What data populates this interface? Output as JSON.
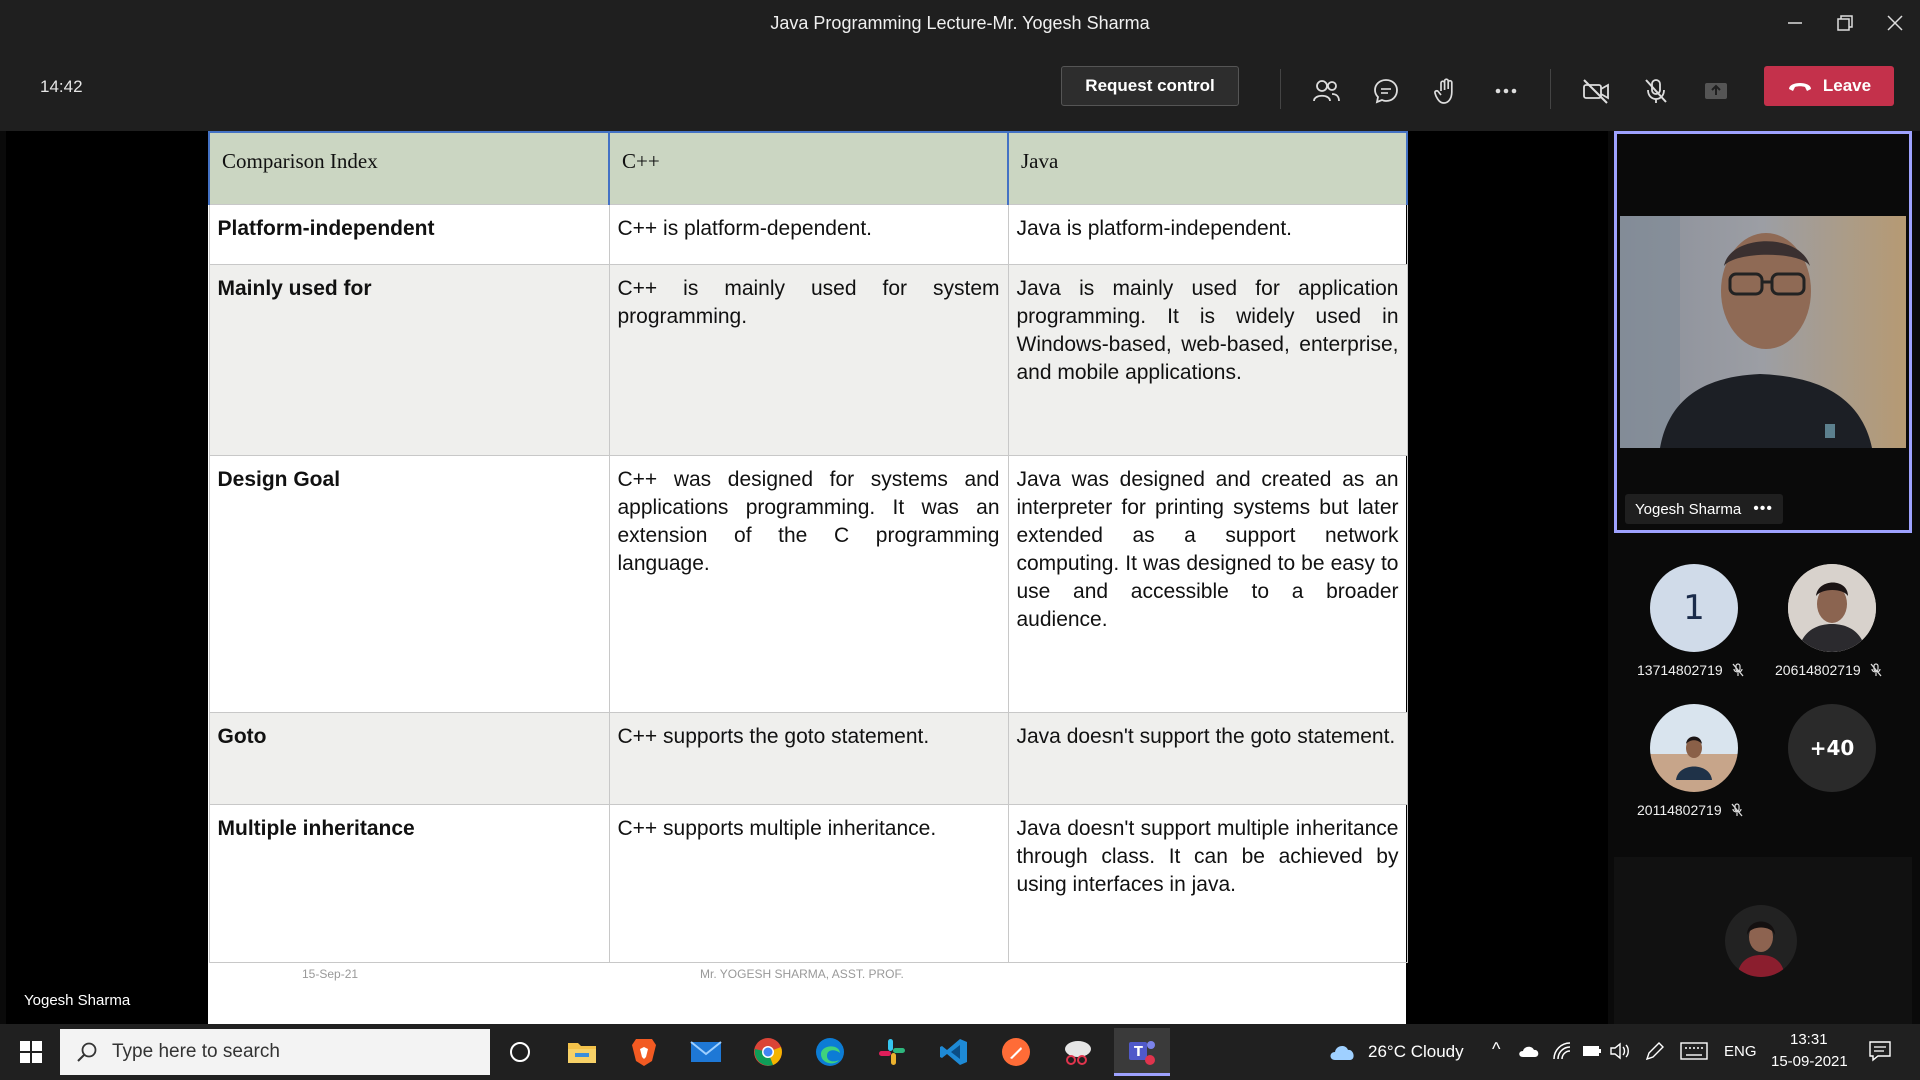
{
  "window": {
    "title": "Java Programming Lecture-Mr. Yogesh Sharma",
    "controls": [
      "minimize-icon",
      "restore-icon",
      "close-icon"
    ]
  },
  "toolbar": {
    "timer": "14:42",
    "request_control_label": "Request control",
    "leave_label": "Leave",
    "icons": [
      "participants-icon",
      "chat-icon",
      "raise-hand-icon",
      "more-icon",
      "camera-off-icon",
      "mic-off-icon",
      "share-icon",
      "phone-hangup-icon"
    ],
    "leave_color": "#c4314b"
  },
  "slide": {
    "headers": [
      "Comparison Index",
      "C++",
      "Java"
    ],
    "rows": [
      {
        "index": "Platform-independent",
        "cpp": "C++ is platform-dependent.",
        "java": "Java is platform-independent."
      },
      {
        "index": "Mainly used for",
        "cpp": "C++ is mainly used for system programming.",
        "java": "Java is mainly used for application programming. It is widely used in Windows-based, web-based, enterprise, and mobile applications."
      },
      {
        "index": "Design Goal",
        "cpp": "C++ was designed for systems and applications programming. It was an extension of the C programming language.",
        "java": "Java was designed and created as an interpreter for printing systems but later extended as a support network computing. It was designed to be easy to use and accessible to a broader audience."
      },
      {
        "index": "Goto",
        "cpp": "C++ supports the goto statement.",
        "java": "Java doesn't support the goto statement."
      },
      {
        "index": "Multiple inheritance",
        "cpp": "C++ supports multiple inheritance.",
        "java": "Java doesn't support multiple inheritance through class. It can be achieved by using interfaces in java."
      }
    ],
    "footer_date": "15-Sep-21",
    "footer_author": "Mr. YOGESH SHARMA, ASST. PROF.",
    "header_bg": "#cbd6c2"
  },
  "stage": {
    "presenter_name": "Yogesh Sharma"
  },
  "participants": {
    "featured_name": "Yogesh Sharma",
    "featured_border": "#9ea2ff",
    "tiles": [
      {
        "label": "1",
        "name": "13714802719"
      },
      {
        "label": "",
        "name": "20614802719"
      },
      {
        "label": "",
        "name": "20114802719"
      },
      {
        "label": "+40",
        "name": ""
      }
    ]
  },
  "taskbar": {
    "search_placeholder": "Type here to search",
    "apps": [
      "task-view-icon",
      "file-explorer-icon",
      "brave-icon",
      "mail-icon",
      "chrome-icon",
      "edge-icon",
      "slack-icon",
      "vscode-icon",
      "postman-icon",
      "snipping-tool-icon",
      "teams-icon"
    ],
    "weather": "26°C  Cloudy",
    "language": "ENG",
    "time": "13:31",
    "date": "15-09-2021"
  }
}
